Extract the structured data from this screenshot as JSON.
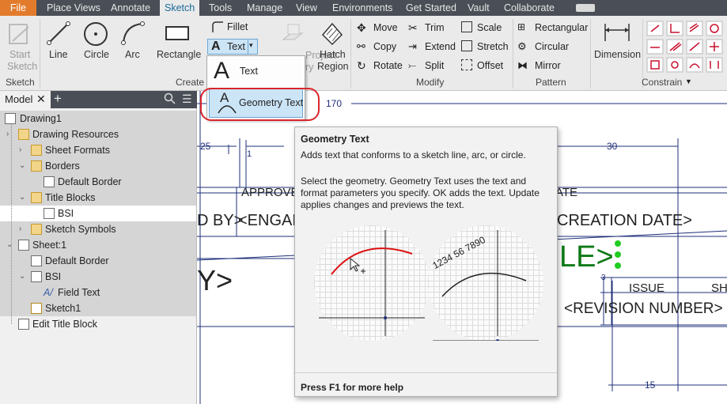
{
  "menu": {
    "tabs": [
      "File",
      "Place Views",
      "Annotate",
      "Sketch",
      "Tools",
      "Manage",
      "View",
      "Environments",
      "Get Started",
      "Vault",
      "Collaborate"
    ]
  },
  "ribbon": {
    "start_sketch": {
      "line1": "Start",
      "line2": "Sketch"
    },
    "line": "Line",
    "circle": "Circle",
    "arc": "Arc",
    "rectangle": "Rectangle",
    "fillet": "Fillet",
    "text": "Text",
    "project": "Project",
    "project_suffix": "ry",
    "hatch": {
      "line1": "Hatch",
      "line2": "Region"
    },
    "move": "Move",
    "copy": "Copy",
    "rotate": "Rotate",
    "trim": "Trim",
    "extend": "Extend",
    "split": "Split",
    "scale": "Scale",
    "stretch": "Stretch",
    "offset": "Offset",
    "rectangular": "Rectangular",
    "circular": "Circular",
    "mirror": "Mirror",
    "dimension": "Dimension",
    "groups": {
      "sketch": "Sketch",
      "create": "Create",
      "modify": "Modify",
      "pattern": "Pattern",
      "constrain": "Constrain"
    }
  },
  "dropdown": {
    "text": "Text",
    "geometry_text": "Geometry Text"
  },
  "browser": {
    "tab": "Model",
    "tree": [
      {
        "label": "Drawing1"
      },
      {
        "label": "Drawing Resources"
      },
      {
        "label": "Sheet Formats"
      },
      {
        "label": "Borders"
      },
      {
        "label": "Default Border"
      },
      {
        "label": "Title Blocks"
      },
      {
        "label": "BSI"
      },
      {
        "label": "Sketch Symbols"
      },
      {
        "label": "Sheet:1"
      },
      {
        "label": "Default Border"
      },
      {
        "label": "BSI"
      },
      {
        "label": "Field Text"
      },
      {
        "label": "Sketch1"
      },
      {
        "label": "Edit Title Block"
      }
    ]
  },
  "canvas": {
    "dim_170": "170",
    "dim_25": "25",
    "dim_1": "1",
    "dim_30": "30",
    "dim_15": "15",
    "dim_3": "3",
    "approved": "APPROVE",
    "ate": "ATE",
    "d_by": "D BY>",
    "engar": "<ENGAR",
    "creation_date": "CREATION DATE>",
    "le": "LE>",
    "y": "Y>",
    "issue": "ISSUE",
    "sh": "SH",
    "revision": "<REVISION NUMBER>"
  },
  "tooltip": {
    "title": "Geometry Text",
    "desc": "Adds text that conforms to a sketch line, arc, or circle.",
    "body": "Select the geometry. Geometry Text uses the text and format parameters you specify. OK adds the text. Update applies changes and previews the text.",
    "sample": "1234 56 7890",
    "footer": "Press F1 for more help"
  }
}
